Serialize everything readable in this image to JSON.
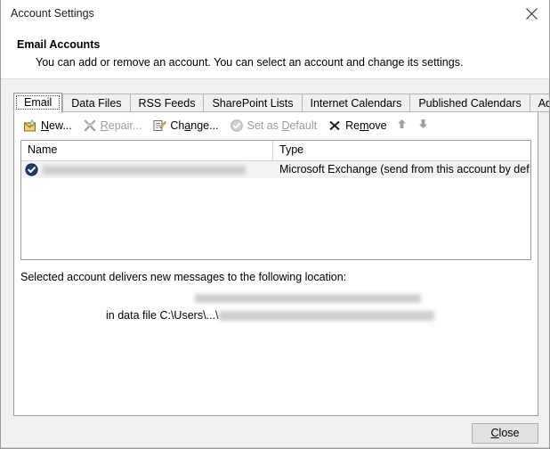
{
  "window": {
    "title": "Account Settings",
    "close_icon": "close-x-icon"
  },
  "header": {
    "title": "Email Accounts",
    "subtitle": "You can add or remove an account. You can select an account and change its settings."
  },
  "tabs": [
    {
      "label": "Email",
      "active": true
    },
    {
      "label": "Data Files",
      "active": false
    },
    {
      "label": "RSS Feeds",
      "active": false
    },
    {
      "label": "SharePoint Lists",
      "active": false
    },
    {
      "label": "Internet Calendars",
      "active": false
    },
    {
      "label": "Published Calendars",
      "active": false
    },
    {
      "label": "Address Books",
      "active": false
    }
  ],
  "toolbar": {
    "new": {
      "label": "New...",
      "accel": "N",
      "icon": "new-account-envelope-icon",
      "enabled": true
    },
    "repair": {
      "label": "Repair...",
      "accel": "R",
      "icon": "repair-wrench-icon",
      "enabled": false
    },
    "change": {
      "label": "Change...",
      "accel": "a",
      "icon": "change-account-icon",
      "enabled": true
    },
    "set_default": {
      "label": "Set as Default",
      "accel": "D",
      "icon": "set-default-check-icon",
      "enabled": false
    },
    "remove": {
      "label": "Remove",
      "accel": "m",
      "icon": "remove-x-icon",
      "enabled": true
    },
    "move_up": {
      "icon": "arrow-up-icon",
      "enabled": true
    },
    "move_down": {
      "icon": "arrow-down-icon",
      "enabled": true
    }
  },
  "account_list": {
    "columns": [
      "Name",
      "Type"
    ],
    "rows": [
      {
        "icon": "default-account-check-icon",
        "name": "",
        "name_redacted": true,
        "type": "Microsoft Exchange (send from this account by def..."
      }
    ]
  },
  "delivery": {
    "label": "Selected account delivers new messages to the following location:",
    "location": "",
    "location_redacted": true,
    "data_file_prefix": "in data file C:\\Users\\...\\",
    "data_file_path": "",
    "data_file_redacted": true
  },
  "footer": {
    "close_label_pre": "",
    "close_accel": "C",
    "close_label_post": "lose"
  },
  "colors": {
    "dialog_bg": "#f0f0f0",
    "panel_bg": "#ffffff",
    "border": "#9c9c9c",
    "tab_border": "#b4b4b4",
    "row_selected": "#f3f3f3",
    "disabled_text": "#9d9d9d",
    "accent_icon": "#1f3a6e"
  }
}
